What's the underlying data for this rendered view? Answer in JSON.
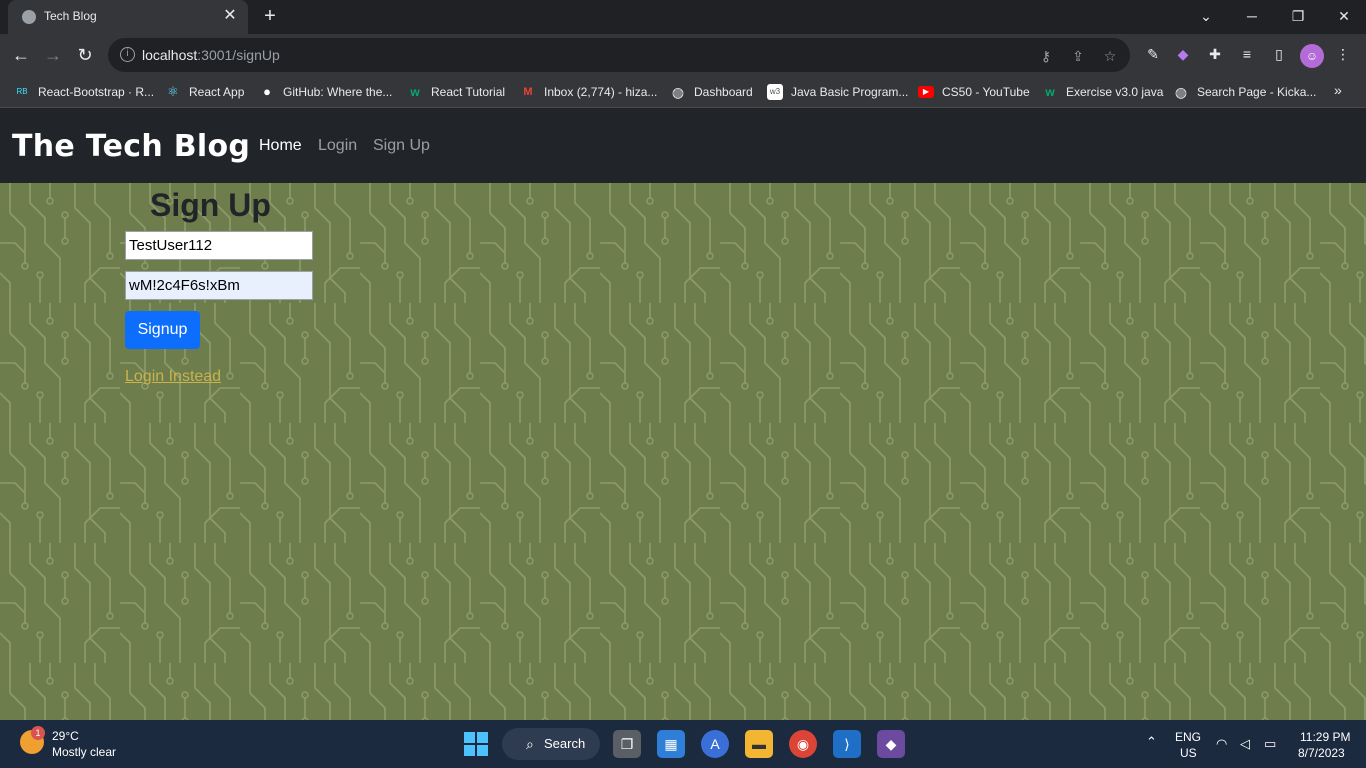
{
  "browser": {
    "tab_title": "Tech Blog",
    "tab_close": "✕",
    "new_tab": "+",
    "url_host": "localhost",
    "url_path": ":3001/signUp"
  },
  "bookmarks": [
    {
      "label": "React-Bootstrap · R...",
      "icon_color": "#41e0fd",
      "icon_glyph": "RB"
    },
    {
      "label": "React App",
      "icon_color": "#61dafb",
      "icon_glyph": "⚛"
    },
    {
      "label": "GitHub: Where the...",
      "icon_color": "#ffffff",
      "icon_glyph": "●"
    },
    {
      "label": "React Tutorial",
      "icon_color": "#04aa6d",
      "icon_glyph": "w"
    },
    {
      "label": "Inbox (2,774) - hiza...",
      "icon_color": "#ea4335",
      "icon_glyph": "M"
    },
    {
      "label": "Dashboard",
      "icon_color": "#e8eaed",
      "icon_glyph": "◍"
    },
    {
      "label": "Java Basic Program...",
      "icon_color": "#ffffff",
      "icon_glyph": "w3"
    },
    {
      "label": "CS50 - YouTube",
      "icon_color": "#ff0000",
      "icon_glyph": "▶"
    },
    {
      "label": "Exercise v3.0 java",
      "icon_color": "#04aa6d",
      "icon_glyph": "w"
    },
    {
      "label": "Search Page - Kicka...",
      "icon_color": "#e8eaed",
      "icon_glyph": "◍"
    }
  ],
  "navbar": {
    "brand": "The Tech Blog",
    "links": [
      "Home",
      "Login",
      "Sign Up"
    ]
  },
  "signup": {
    "title": "Sign Up",
    "username_value": "TestUser112",
    "password_value": "wM!2c4F6s!xBm",
    "submit_label": "Signup",
    "login_link": "Login Instead"
  },
  "taskbar": {
    "weather_badge": "1",
    "temperature": "29°C",
    "condition": "Mostly clear",
    "search_label": "Search",
    "language": "ENG",
    "region": "US",
    "time": "11:29 PM",
    "date": "8/7/2023"
  },
  "colors": {
    "page_bg": "#6d7d4b",
    "navbar_bg": "#212529",
    "primary_button": "#0d6efd",
    "link": "#c9b34e"
  }
}
